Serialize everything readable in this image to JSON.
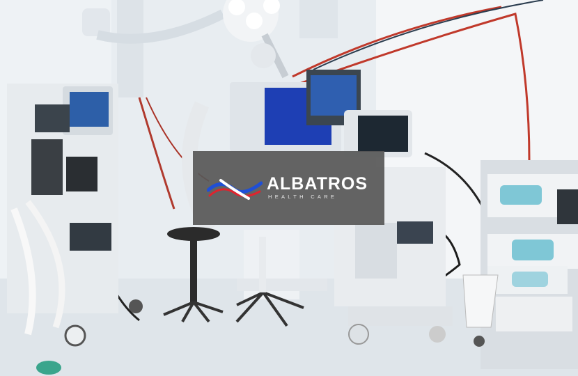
{
  "brand": {
    "name": "ALBATROS",
    "subtitle": "HEALTH CARE"
  },
  "colors": {
    "card_background": "#585858",
    "logo_blue": "#1f4fd6",
    "logo_red": "#e0232e",
    "wall": "#eef2f5",
    "floor": "#dfe5ea",
    "screen_blue": "#1e3fb4"
  },
  "icons": {
    "logo_mark": "albatros-wave-logo-icon"
  }
}
